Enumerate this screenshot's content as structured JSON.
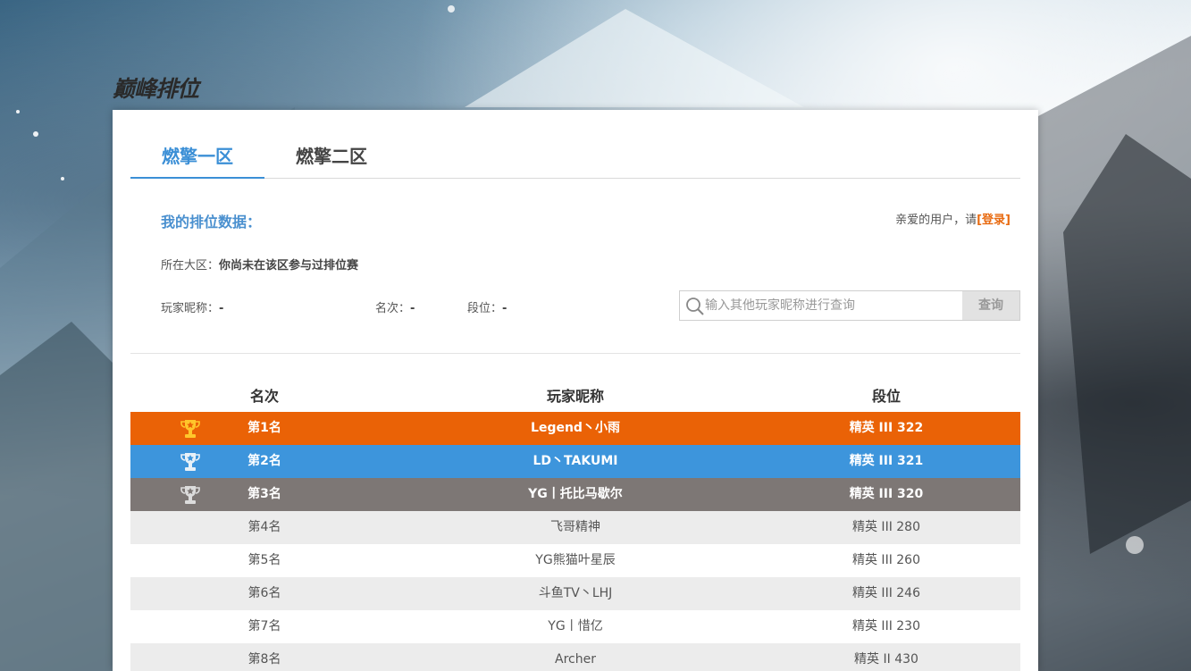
{
  "page_title": "巅峰排位",
  "tabs": [
    {
      "label": "燃擎一区",
      "active": true
    },
    {
      "label": "燃擎二区",
      "active": false
    }
  ],
  "my_rank": {
    "title": "我的排位数据：",
    "login_prefix": "亲爱的用户，请",
    "login_link": "[登录]",
    "region_label": "所在大区：",
    "region_value": "你尚未在该区参与过排位赛",
    "nick_label": "玩家昵称：",
    "nick_value": "-",
    "rank_label": "名次：",
    "rank_value": "-",
    "tier_label": "段位：",
    "tier_value": "-"
  },
  "search": {
    "placeholder": "输入其他玩家昵称进行查询",
    "value": "",
    "button": "查询"
  },
  "table": {
    "headers": {
      "rank": "名次",
      "name": "玩家昵称",
      "tier": "段位"
    },
    "rows": [
      {
        "rank": "第1名",
        "name": "Legend丶小雨",
        "tier": "精英 III 322",
        "trophy": "gold-trophy-icon"
      },
      {
        "rank": "第2名",
        "name": "LD丶TAKUMI",
        "tier": "精英 III 321",
        "trophy": "silver-trophy-icon"
      },
      {
        "rank": "第3名",
        "name": "YG丨托比马歇尔",
        "tier": "精英 III 320",
        "trophy": "bronze-trophy-icon"
      },
      {
        "rank": "第4名",
        "name": "飞哥精神",
        "tier": "精英 III 280"
      },
      {
        "rank": "第5名",
        "name": "YG熊猫叶星辰",
        "tier": "精英 III 260"
      },
      {
        "rank": "第6名",
        "name": "斗鱼TV丶LHJ",
        "tier": "精英 III 246"
      },
      {
        "rank": "第7名",
        "name": "YG丨惜亿",
        "tier": "精英 III 230"
      },
      {
        "rank": "第8名",
        "name": "Archer",
        "tier": "精英 II 430"
      }
    ]
  },
  "colors": {
    "accent": "#3b8fd6",
    "first": "#ea6206",
    "second": "#3d95dc",
    "third": "#7d7775",
    "login": "#e86a10"
  }
}
